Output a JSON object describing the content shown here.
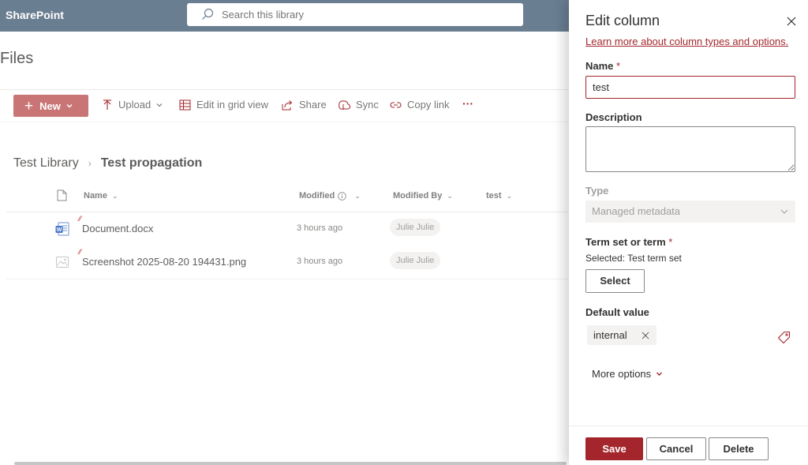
{
  "app": {
    "brand": "SharePoint"
  },
  "search": {
    "placeholder": "Search this library"
  },
  "page": {
    "title": "Files"
  },
  "commandbar": {
    "new_label": "New",
    "upload_label": "Upload",
    "grid_label": "Edit in grid view",
    "share_label": "Share",
    "sync_label": "Sync",
    "copylink_label": "Copy link",
    "more_label": "···"
  },
  "breadcrumb": {
    "parent": "Test Library",
    "separator": "›",
    "current": "Test propagation"
  },
  "columns": {
    "name": "Name",
    "modified": "Modified",
    "modified_by": "Modified By",
    "test": "test"
  },
  "files": [
    {
      "name": "Document.docx",
      "modified": "3 hours ago",
      "modified_by": "Julie Julie",
      "icon": "word-file-icon"
    },
    {
      "name": "Screenshot 2025-08-20 194431.png",
      "modified": "3 hours ago",
      "modified_by": "Julie Julie",
      "icon": "image-file-icon"
    }
  ],
  "panel": {
    "title": "Edit column",
    "learn_link": "Learn more about column types and options.",
    "name_label": "Name",
    "required_mark": "*",
    "name_value": "test",
    "description_label": "Description",
    "description_value": "",
    "type_label": "Type",
    "type_value": "Managed metadata",
    "termset_label": "Term set or term",
    "selected_text": "Selected: Test term set",
    "select_button": "Select",
    "default_label": "Default value",
    "default_tag": "internal",
    "more_options": "More options",
    "save": "Save",
    "cancel": "Cancel",
    "delete": "Delete"
  },
  "colors": {
    "accent": "#a4262c",
    "topbar": "#6a7e92",
    "new_button": "#c97576"
  }
}
